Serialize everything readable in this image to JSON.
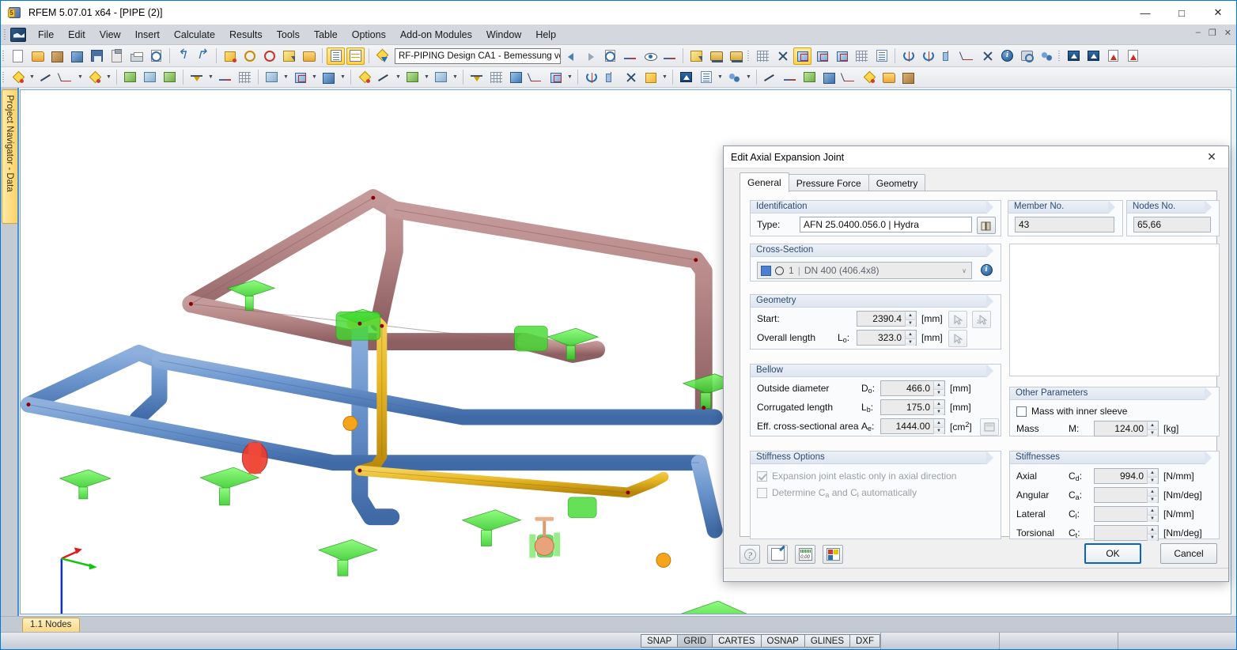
{
  "window": {
    "title": "RFEM 5.07.01 x64 - [PIPE (2)]",
    "app_icon": "rfem-logo-icon",
    "controls": {
      "minimize": "—",
      "maximize": "□",
      "close": "✕"
    },
    "mdi_controls": {
      "minimize": "–",
      "restore": "❐",
      "close": "✕"
    }
  },
  "menu": {
    "items": [
      {
        "label": "File"
      },
      {
        "label": "Edit"
      },
      {
        "label": "View"
      },
      {
        "label": "Insert"
      },
      {
        "label": "Calculate"
      },
      {
        "label": "Results"
      },
      {
        "label": "Tools"
      },
      {
        "label": "Table"
      },
      {
        "label": "Options"
      },
      {
        "label": "Add-on Modules"
      },
      {
        "label": "Window"
      },
      {
        "label": "Help"
      }
    ]
  },
  "toolbar": {
    "module_combo": {
      "value": "RF-PIPING Design CA1 - Bemessung vo",
      "arrow": "▾"
    },
    "row1_icons": [
      "new-document-icon",
      "open-folder-icon",
      "open-package-icon",
      "open-model-icon",
      "save-icon",
      "clipboard-icon",
      "print-icon",
      "print-preview-icon",
      "undo-icon",
      "redo-icon",
      "generate-icon",
      "zoom-area-icon",
      "zoom-circle-icon",
      "select-plus-icon",
      "restore-window-icon",
      "table-list-icon",
      "table-grid-icon",
      "addon-module-icon"
    ],
    "row1_right_icons": [
      "nav-back-icon",
      "nav-forward-icon",
      "print-report-icon",
      "dimension-icon",
      "render-view-icon",
      "value-view-icon",
      "visibility-icon",
      "loads-bus-icon",
      "loads-bus2-icon",
      "mesh-icon",
      "mesh-settings-icon",
      "axonometric-view-icon",
      "view-xz-icon",
      "view-yz-icon",
      "fe-mesh-icon",
      "result-window-icon",
      "rotate-node-icon",
      "rotate-axis-icon",
      "mirror-icon",
      "dimension-line-icon",
      "delete-node-icon",
      "info-icon",
      "camera-icon",
      "settings-gears-icon",
      "export-dxf-icon",
      "import-dxf-icon",
      "pdf-export-icon",
      "pdf-import-icon"
    ],
    "row2_icons": [
      "new-node-icon",
      "new-line-icon",
      "new-dimension-icon",
      "new-polyline-icon",
      "new-surface-icon",
      "new-member-icon",
      "new-solid-icon",
      "new-support-icon",
      "new-hinge-icon",
      "new-grid-icon",
      "new-load-icon",
      "new-opening-icon",
      "new-section-icon"
    ]
  },
  "navigator": {
    "tab_label": "Project Navigator - Data"
  },
  "viewport": {
    "axes": {
      "x": "x",
      "y": "y",
      "z": "z"
    }
  },
  "bottom_tabs": {
    "active": "1.1 Nodes"
  },
  "statusbar": {
    "toggles": [
      {
        "label": "SNAP",
        "active": false
      },
      {
        "label": "GRID",
        "active": true
      },
      {
        "label": "CARTES",
        "active": false
      },
      {
        "label": "OSNAP",
        "active": false
      },
      {
        "label": "GLINES",
        "active": false
      },
      {
        "label": "DXF",
        "active": false
      }
    ]
  },
  "dialog": {
    "title": "Edit Axial Expansion Joint",
    "close_icon": "close-icon",
    "tabs": [
      {
        "label": "General",
        "selected": true
      },
      {
        "label": "Pressure Force",
        "selected": false
      },
      {
        "label": "Geometry",
        "selected": false
      }
    ],
    "identification": {
      "legend": "Identification",
      "type_label": "Type:",
      "type_value": "AFN 25.0400.056.0 | Hydra",
      "library_button_icon": "library-book-icon"
    },
    "member_no": {
      "legend": "Member No.",
      "value": "43"
    },
    "nodes_no": {
      "legend": "Nodes No.",
      "value": "65,66"
    },
    "cross_section": {
      "legend": "Cross-Section",
      "color_swatch": "#4a7fd4",
      "shape_icon": "circle-section-icon",
      "number": "1",
      "description": "DN 400 (406.4x8)",
      "dropdown_arrow": "∨",
      "info_button_icon": "info-icon"
    },
    "geometry": {
      "legend": "Geometry",
      "rows": [
        {
          "label": "Start:",
          "symbol": "",
          "value": "2390.4",
          "unit": "[mm]",
          "buttons": [
            "pick-point-icon",
            "pick-two-points-icon"
          ]
        },
        {
          "label": "Overall length",
          "symbol": "L",
          "symbol_sub": "o",
          "symbol_suffix": ":",
          "value": "323.0",
          "unit": "[mm]",
          "buttons": [
            "pick-point-icon"
          ]
        }
      ]
    },
    "bellow": {
      "legend": "Bellow",
      "rows": [
        {
          "label": "Outside diameter",
          "symbol": "D",
          "symbol_sub": "o",
          "symbol_suffix": ":",
          "value": "466.0",
          "unit": "[mm]",
          "button": null
        },
        {
          "label": "Corrugated length",
          "symbol": "L",
          "symbol_sub": "b",
          "symbol_suffix": ":",
          "value": "175.0",
          "unit": "[mm]",
          "button": null
        },
        {
          "label": "Eff. cross-sectional area",
          "symbol": "A",
          "symbol_sub": "e",
          "symbol_suffix": ":",
          "value": "1444.00",
          "unit": "[cm",
          "unit_sup": "2",
          "unit_end": "]",
          "button": "calculator-icon"
        }
      ]
    },
    "stiffness_options": {
      "legend": "Stiffness Options",
      "checkboxes": [
        {
          "label": "Expansion joint elastic only in axial direction",
          "checked": true,
          "disabled": true
        },
        {
          "label_pre": "Determine C",
          "label_sub1": "a",
          "label_mid": " and C",
          "label_sub2": "l",
          "label_post": " automatically",
          "checked": false,
          "disabled": true
        }
      ]
    },
    "other_parameters": {
      "legend": "Other Parameters",
      "checkbox": {
        "label": "Mass with inner sleeve",
        "checked": false
      },
      "mass_label": "Mass",
      "mass_symbol": "M:",
      "mass_value": "124.00",
      "mass_unit": "[kg]"
    },
    "stiffnesses": {
      "legend": "Stiffnesses",
      "rows": [
        {
          "label": "Axial",
          "symbol": "C",
          "symbol_sub": "d",
          "symbol_suffix": ":",
          "value": "994.0",
          "unit": "[N/mm]"
        },
        {
          "label": "Angular",
          "symbol": "C",
          "symbol_sub": "a",
          "symbol_suffix": ":",
          "value": "",
          "unit": "[Nm/deg]"
        },
        {
          "label": "Lateral",
          "symbol": "C",
          "symbol_sub": "l",
          "symbol_suffix": ":",
          "value": "",
          "unit": "[N/mm]"
        },
        {
          "label": "Torsional",
          "symbol": "C",
          "symbol_sub": "t",
          "symbol_suffix": ":",
          "value": "",
          "unit": "[Nm/deg]"
        }
      ]
    },
    "footer": {
      "icons": [
        "help-icon",
        "comment-icon",
        "units-icon",
        "display-properties-icon"
      ],
      "ok_label": "OK",
      "cancel_label": "Cancel"
    }
  }
}
